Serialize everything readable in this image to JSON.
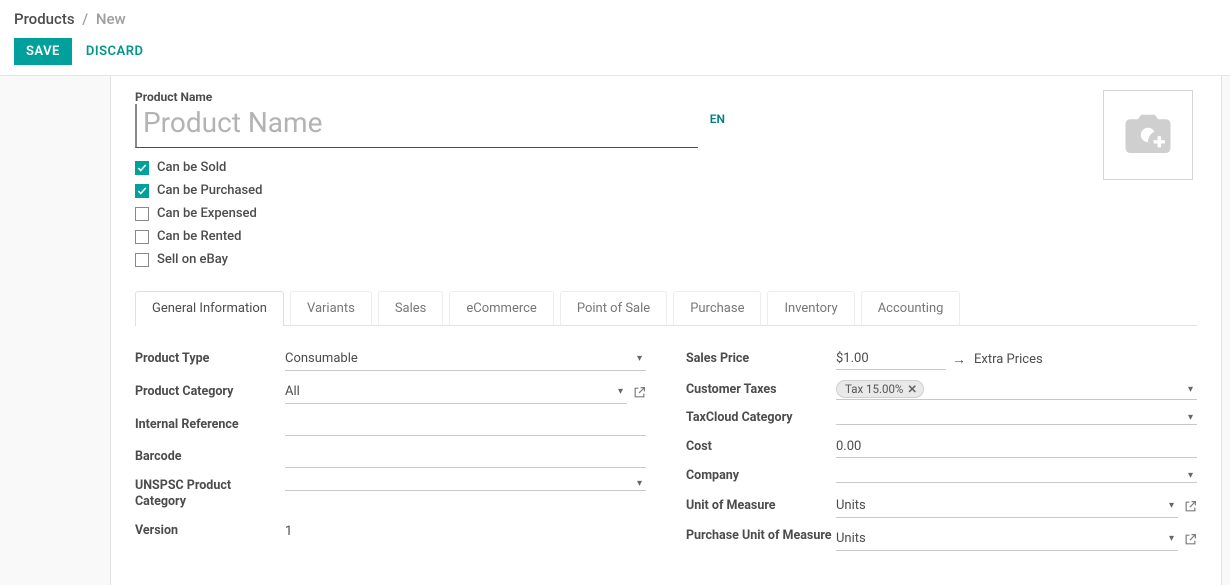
{
  "breadcrumb": {
    "main": "Products",
    "sub": "New"
  },
  "actions": {
    "save": "SAVE",
    "discard": "DISCARD"
  },
  "product_name": {
    "label": "Product Name",
    "placeholder": "Product Name",
    "value": "",
    "lang": "EN"
  },
  "checks": {
    "can_be_sold": "Can be Sold",
    "can_be_purchased": "Can be Purchased",
    "can_be_expensed": "Can be Expensed",
    "can_be_rented": "Can be Rented",
    "sell_on_ebay": "Sell on eBay"
  },
  "tabs": {
    "general": "General Information",
    "variants": "Variants",
    "sales": "Sales",
    "ecommerce": "eCommerce",
    "pos": "Point of Sale",
    "purchase": "Purchase",
    "inventory": "Inventory",
    "accounting": "Accounting"
  },
  "left": {
    "product_type": {
      "label": "Product Type",
      "value": "Consumable"
    },
    "product_category": {
      "label": "Product Category",
      "value": "All"
    },
    "internal_ref": {
      "label": "Internal Reference",
      "value": ""
    },
    "barcode": {
      "label": "Barcode",
      "value": ""
    },
    "unspsc": {
      "label": "UNSPSC Product Category",
      "value": ""
    },
    "version": {
      "label": "Version",
      "value": "1"
    }
  },
  "right": {
    "sales_price": {
      "label": "Sales Price",
      "value": "$1.00",
      "extra": "Extra Prices"
    },
    "customer_taxes": {
      "label": "Customer Taxes",
      "tag": "Tax 15.00%"
    },
    "taxcloud": {
      "label": "TaxCloud Category",
      "value": ""
    },
    "cost": {
      "label": "Cost",
      "value": "0.00"
    },
    "company": {
      "label": "Company",
      "value": ""
    },
    "uom": {
      "label": "Unit of Measure",
      "value": "Units"
    },
    "purchase_uom": {
      "label": "Purchase Unit of Measure",
      "value": "Units"
    }
  }
}
